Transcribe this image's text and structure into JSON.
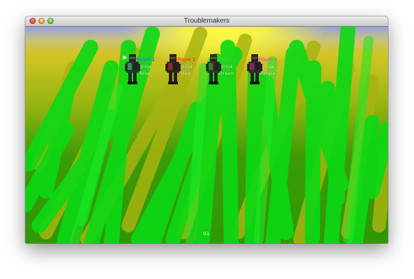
{
  "window": {
    "title": "Troublemakers"
  },
  "players": [
    {
      "name": "Player 1",
      "character": "Ninja",
      "color": "Blue",
      "name_color": "#3f6cff",
      "sprite_accent": "#3e8a66",
      "selected": true
    },
    {
      "name": "Player 2",
      "character": "Ninja",
      "color": "Red",
      "name_color": "#ff3a3a",
      "sprite_accent": "#8a2c2c",
      "selected": false
    },
    {
      "name": "Player 3",
      "character": "Ninja",
      "color": "Green",
      "name_color": "#33d24a",
      "sprite_accent": "#3f7a2c",
      "selected": false
    },
    {
      "name": "Player 4",
      "character": "Ninja",
      "color": "Purple",
      "name_color": "#ff4fb0",
      "sprite_accent": "#7a2c55",
      "selected": false
    }
  ],
  "selection_cursor": "▶",
  "status_text": "01",
  "colors": {
    "stroke_green": "#0bd914",
    "sky_yellow": "#fffb3a",
    "grass": "#2f9804"
  }
}
